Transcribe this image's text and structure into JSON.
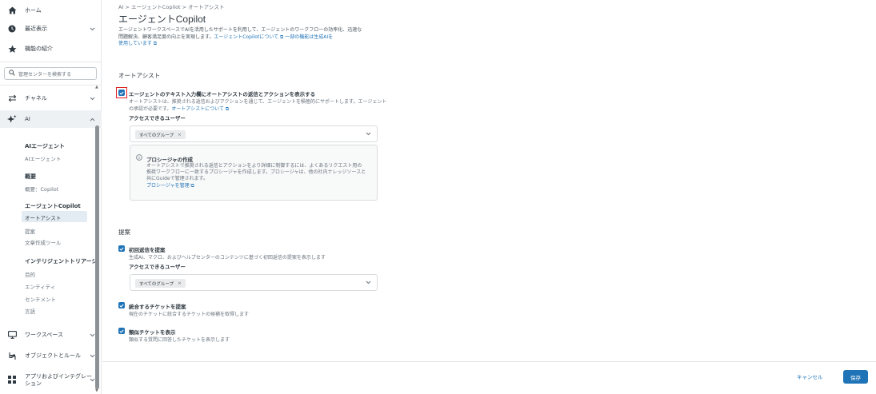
{
  "sidebar": {
    "top_items": [
      {
        "label": "ホーム",
        "icon": "home-icon"
      },
      {
        "label": "最近表示",
        "icon": "clock-icon"
      },
      {
        "label": "機能の紹介",
        "icon": "star-icon"
      }
    ],
    "search_placeholder": "管理センターを検索する",
    "channels_label": "チャネル",
    "ai_label": "AI",
    "ai_groups": [
      {
        "title": "AIエージェント",
        "items": [
          "AIエージェント"
        ]
      },
      {
        "title": "概要",
        "items": [
          "概要：Copilot"
        ]
      },
      {
        "title": "エージェントCopilot",
        "items": [
          "オートアシスト",
          "提案",
          "文章作成ツール"
        ]
      },
      {
        "title": "インテリジェントトリアージ",
        "items": [
          "目的",
          "エンティティ",
          "センチメント",
          "言語"
        ]
      }
    ],
    "workspace_label": "ワークスペース",
    "objects_label": "オブジェクトとルール",
    "apps_label_1": "アプリおよびインテグレー",
    "apps_label_2": "ション"
  },
  "main": {
    "breadcrumb": "AI > エージェントCopilot > オートアシスト",
    "title": "エージェントCopilot",
    "desc_1": "エージェントワークスペースでAIを活用したサポートを利用して、エージェントのワークフローの効率化、迅速な",
    "desc_2": "問題解決、顧客満足度の向上を実現します。",
    "desc_link1": "エージェントCopilotについて",
    "desc_link2": "一部の機能は生成AIを",
    "desc_link3": "使用しています",
    "autoassist": {
      "heading": "オートアシスト",
      "checkbox_label": "エージェントのテキスト入力欄にオートアシストの返信とアクションを表示する",
      "sub_1": "オートアシストは、推奨される返信およびアクションを通じて、エージェントを積極的にサポートします。エージェント",
      "sub_2": "の承認が必要です。",
      "sub_link": "オートアシストについて",
      "access_label": "アクセスできるユーザー",
      "chip": "すべてのグループ",
      "info_title": "プロシージャの作成",
      "info_1": "オートアシストで推奨される返信とアクションをより詳細に制御するには、よくあるリクエスト用の",
      "info_2": "推奨ワークフローに一致するプロシージャを作成します。プロシージャは、他の社内ナレッジソースと",
      "info_3": "共にGuideで管理されます。",
      "info_link": "プロシージャを管理"
    },
    "suggestions": {
      "heading": "提案",
      "first_reply_label": "初回返信を提案",
      "first_reply_sub": "生成AI、マクロ、およびヘルプセンターのコンテンツに基づく初回返信の提案を表示します",
      "access_label": "アクセスできるユーザー",
      "chip": "すべてのグループ",
      "merge_label": "統合するチケットを提案",
      "merge_sub": "現在のチケットに統合するチケットの候補を取得します",
      "similar_label": "類似チケットを表示",
      "similar_sub": "類似する質問に回答したチケットを表示します"
    },
    "footer": {
      "cancel": "キャンセル",
      "save": "保存"
    }
  },
  "colors": {
    "accent": "#1f73b7",
    "highlight": "#e02020"
  }
}
